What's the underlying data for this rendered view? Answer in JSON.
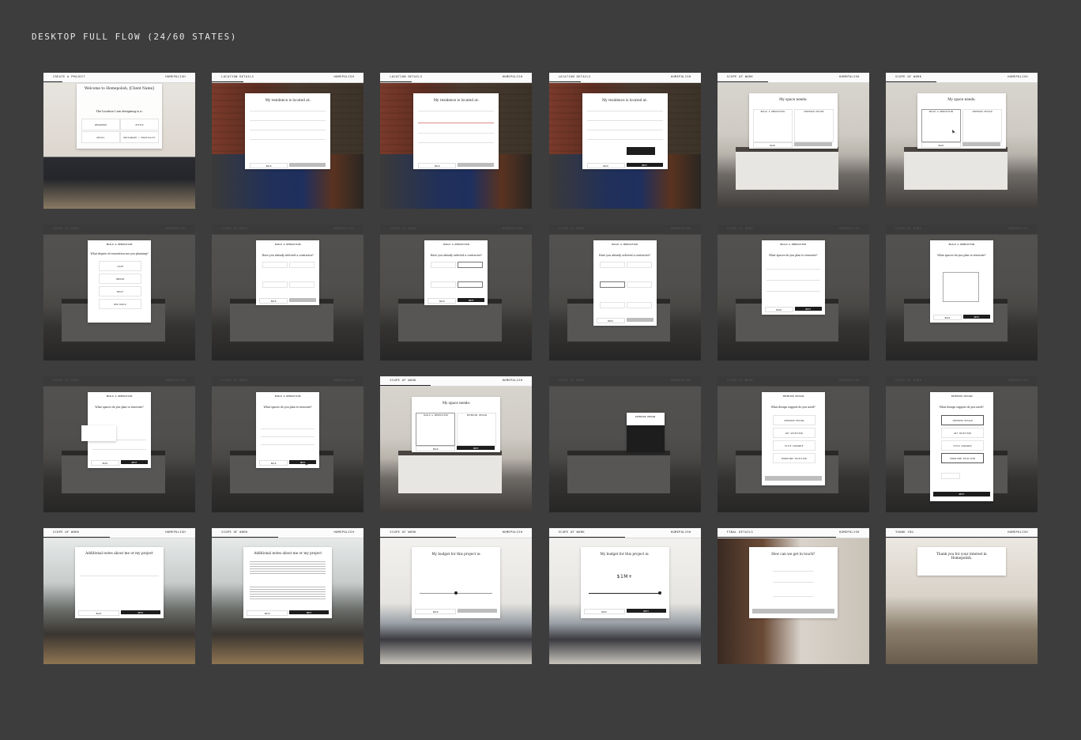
{
  "page": {
    "title": "DESKTOP FULL FLOW (24/60 STATES)"
  },
  "brand": {
    "logo_text": "HOMEPOLISH"
  },
  "colors": {
    "background": "#3d3d3d",
    "modal": "#ffffff",
    "primary_button": "#1d1d1d",
    "disabled_button": "#bdbdbd"
  },
  "states": [
    {
      "step": "CREATE A PROJECT",
      "modal_title": "Welcome to Homepolish, [Client Name]",
      "subtitle": "The location I am designing is a:",
      "options": [
        "RESIDENCE",
        "OFFICE",
        "RETAIL",
        "RESTAURANT / HOSPITALITY"
      ],
      "dimmed": false
    },
    {
      "step": "LOCATION DETAILS",
      "modal_title": "My residence is located at:",
      "dimmed": false
    },
    {
      "step": "LOCATION DETAILS",
      "modal_title": "My residence is located at:",
      "dimmed": false
    },
    {
      "step": "LOCATION DETAILS",
      "modal_title": "My residence is located at:",
      "dimmed": false
    },
    {
      "step": "SCOPE OF WORK",
      "modal_title": "My space needs:",
      "options": [
        "BUILD & RENOVATION",
        "INTERIOR DESIGN"
      ],
      "dimmed": false
    },
    {
      "step": "SCOPE OF WORK",
      "modal_title": "My space needs:",
      "options": [
        "BUILD & RENOVATION",
        "INTERIOR DESIGN"
      ],
      "dimmed": false
    },
    {
      "step": "SCOPE OF WORK",
      "modal_title": "BUILD & RENOVATION",
      "subtitle": "What degree of renovation are you planning?",
      "options": [
        "LIGHT",
        "MEDIUM",
        "HEAVY",
        "NEW BUILD"
      ],
      "dimmed": true
    },
    {
      "step": "SCOPE OF WORK",
      "modal_title": "BUILD & RENOVATION",
      "subtitle": "Have you already selected a contractor?",
      "dimmed": true
    },
    {
      "step": "SCOPE OF WORK",
      "modal_title": "BUILD & RENOVATION",
      "subtitle": "Have you already selected a contractor?",
      "dimmed": true
    },
    {
      "step": "SCOPE OF WORK",
      "modal_title": "BUILD & RENOVATION",
      "subtitle": "Have you already selected a contractor?",
      "dimmed": true
    },
    {
      "step": "SCOPE OF WORK",
      "modal_title": "BUILD & RENOVATION",
      "subtitle": "What spaces do you plan to renovate?",
      "dimmed": true
    },
    {
      "step": "SCOPE OF WORK",
      "modal_title": "BUILD & RENOVATION",
      "subtitle": "What spaces do you plan to renovate?",
      "dimmed": true
    },
    {
      "step": "SCOPE OF WORK",
      "modal_title": "BUILD & RENOVATION",
      "subtitle": "What spaces do you plan to renovate?",
      "dimmed": true
    },
    {
      "step": "SCOPE OF WORK",
      "modal_title": "BUILD & RENOVATION",
      "subtitle": "What spaces do you plan to renovate?",
      "dimmed": true
    },
    {
      "step": "SCOPE OF WORK",
      "modal_title": "My space needs:",
      "options": [
        "BUILD & RENOVATION",
        "INTERIOR DESIGN"
      ],
      "dimmed": false
    },
    {
      "step": "SCOPE OF WORK",
      "modal_title": "INTERIOR DESIGN",
      "dimmed": true
    },
    {
      "step": "SCOPE OF WORK",
      "modal_title": "INTERIOR DESIGN",
      "subtitle": "What design support do you need?",
      "options": [
        "INTERIOR DESIGN",
        "ART SELECTION",
        "STYLE GUIDANCE",
        "FURNITURE SELECTION"
      ],
      "dimmed": true
    },
    {
      "step": "SCOPE OF WORK",
      "modal_title": "INTERIOR DESIGN",
      "subtitle": "What design support do you need?",
      "options": [
        "INTERIOR DESIGN",
        "ART SELECTION",
        "STYLE GUIDANCE",
        "FURNITURE SELECTION"
      ],
      "dimmed": true
    },
    {
      "step": "SCOPE OF WORK",
      "modal_title": "Additional notes about me or my project",
      "dimmed": false
    },
    {
      "step": "SCOPE OF WORK",
      "modal_title": "Additional notes about me or my project",
      "dimmed": false
    },
    {
      "step": "SCOPE OF WORK",
      "modal_title": "My budget for this project is:",
      "dimmed": false
    },
    {
      "step": "SCOPE OF WORK",
      "modal_title": "My budget for this project is:",
      "price": "$1M+",
      "dimmed": false
    },
    {
      "step": "FINAL DETAILS",
      "modal_title": "How can we get in touch?",
      "dimmed": false
    },
    {
      "step": "THANK YOU",
      "modal_title": "Thank you for your interest in Homepolish.",
      "dimmed": false
    }
  ],
  "buttons": {
    "back": "BACK",
    "next": "NEXT"
  }
}
